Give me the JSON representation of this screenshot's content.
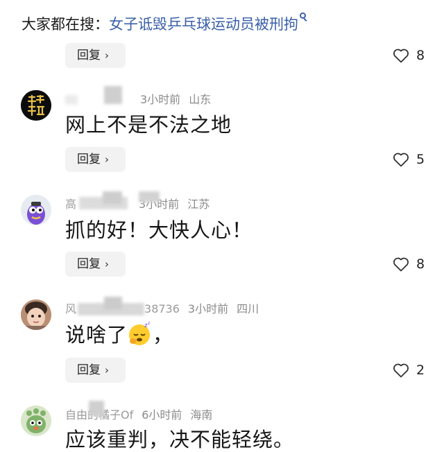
{
  "search": {
    "prefix": "大家都在搜：",
    "query": "女子诋毁乒乓球运动员被刑拘"
  },
  "reply_label": "回复",
  "reply_chevron": "›",
  "top_like": {
    "count": "8"
  },
  "comments": [
    {
      "author": "",
      "time": "3小时前",
      "location": "山东",
      "text": "网上不是不法之地",
      "likes": "5",
      "avatar_icon": "black-avatar-with-chinese-characters"
    },
    {
      "author": "高",
      "time": "3小时前",
      "location": "江苏",
      "text": "抓的好！大快人心！",
      "likes": "8",
      "avatar_icon": "purple-cartoon-avatar"
    },
    {
      "author": "风",
      "author_tail": "38736",
      "time": "3小时前",
      "location": "四川",
      "text": "说啥了",
      "text_tail": "，",
      "likes": "2",
      "avatar_icon": "child-photo-avatar",
      "emoji_icon": "sleepy-face-emoji"
    },
    {
      "author": "自由的橘子Of",
      "time": "6小时前",
      "location": "海南",
      "text": "应该重判，决不能轻绕。",
      "avatar_icon": "green-cartoon-avatar"
    }
  ],
  "colors": {
    "link": "#3a5fa8",
    "meta": "#8a8a8a",
    "reply_bg": "#f2f2f2"
  }
}
